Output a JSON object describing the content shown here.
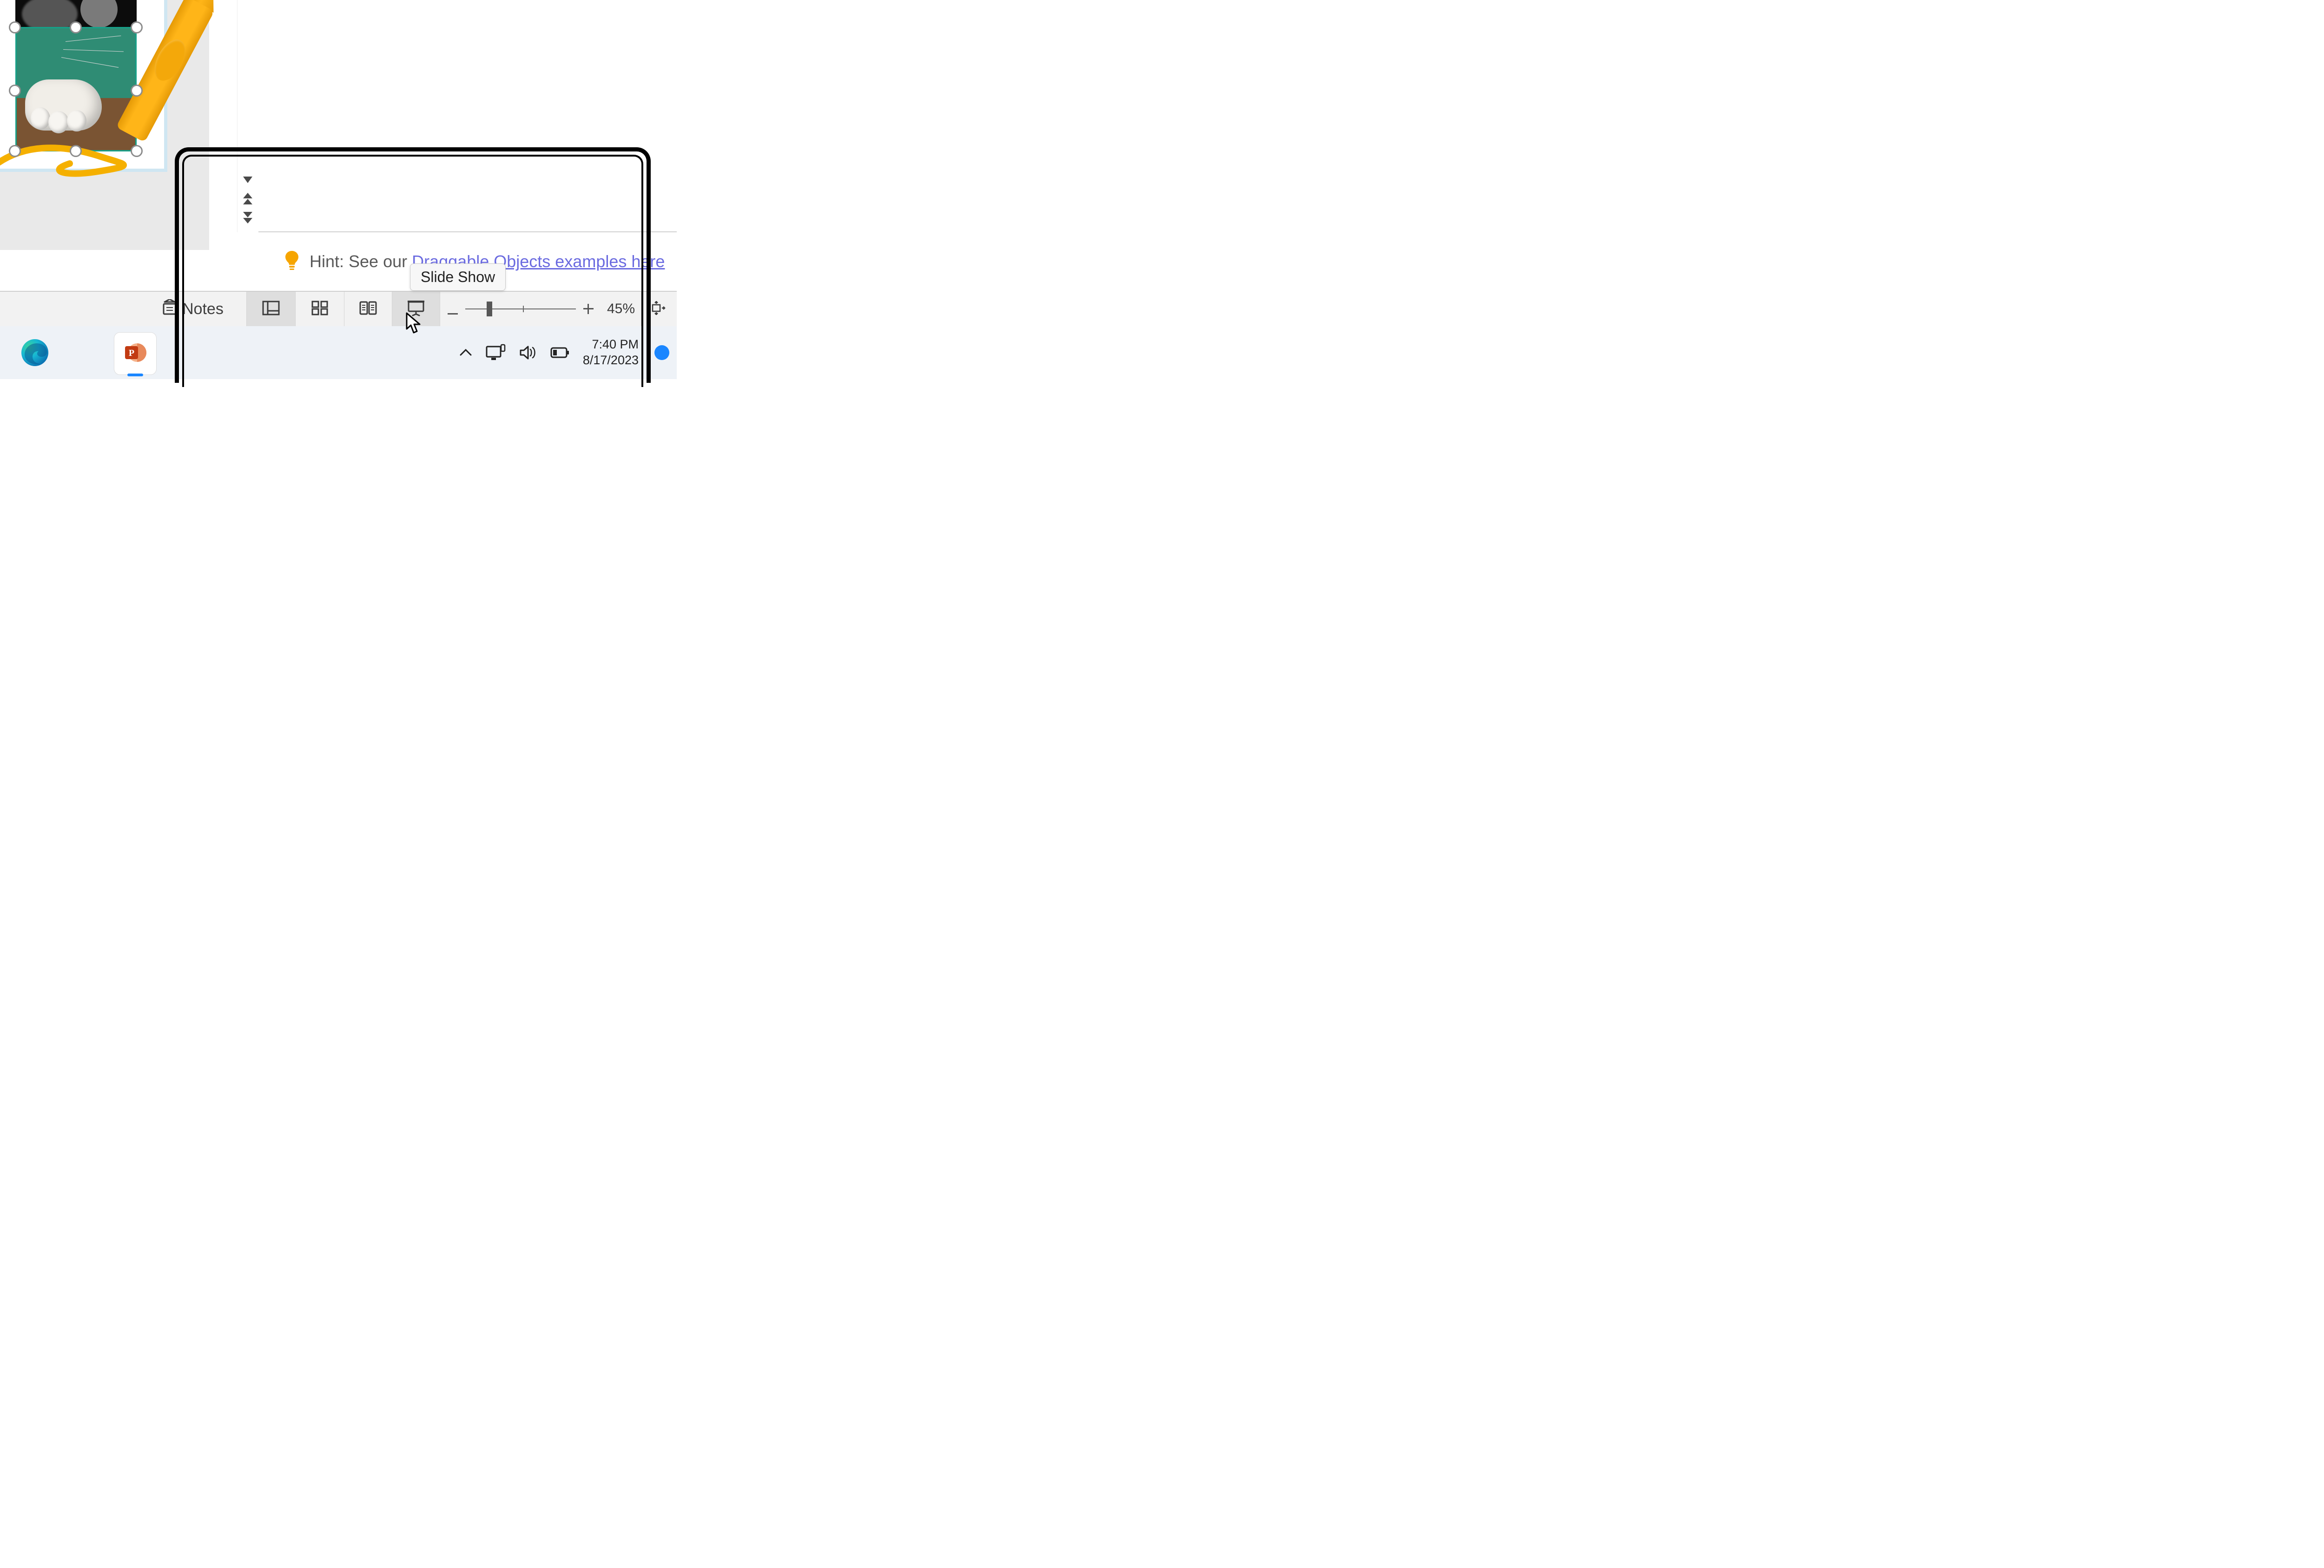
{
  "hint": {
    "prefix": "Hint: See our ",
    "link_text": "Draggable Objects examples here"
  },
  "tooltip": {
    "label": "Slide Show"
  },
  "statusbar": {
    "notes_label": "Notes",
    "zoom_percent": "45%",
    "zoom_slider": {
      "value_pos_pct": 22,
      "tick_pos_pct": 52
    }
  },
  "tray": {
    "time": "7:40 PM",
    "date": "8/17/2023"
  }
}
